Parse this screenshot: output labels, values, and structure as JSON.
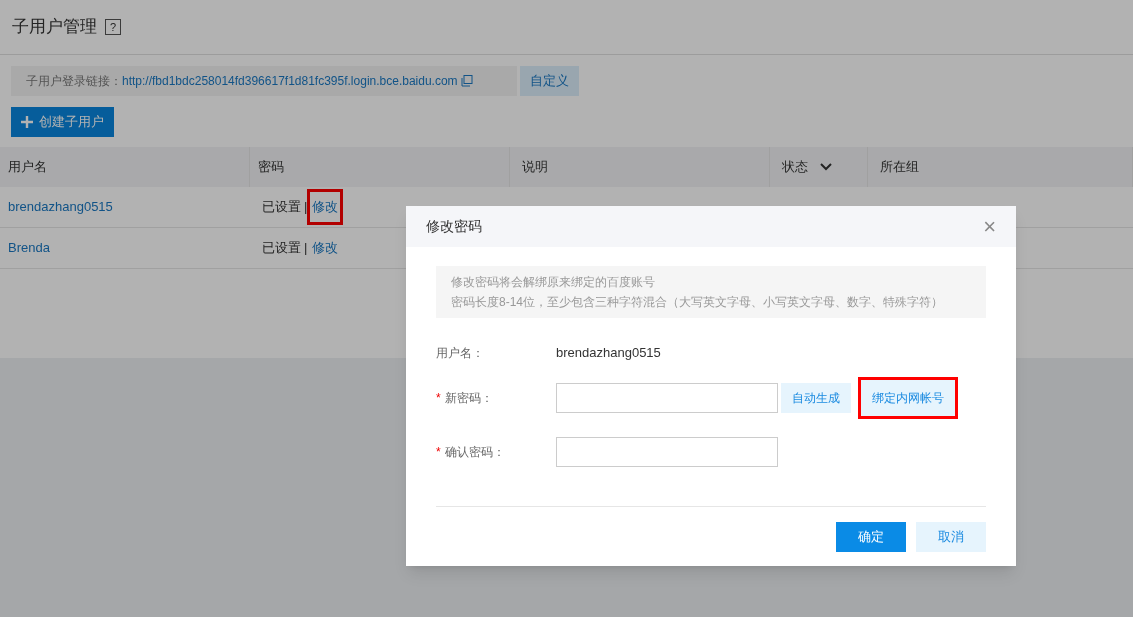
{
  "page": {
    "title": "子用户管理",
    "help": "?"
  },
  "login_link": {
    "label": "子用户登录链接：",
    "url": "http://fbd1bdc258014fd396617f1d81fc395f.login.bce.baidu.com",
    "customize": "自定义"
  },
  "create_button": "创建子用户",
  "table": {
    "columns": [
      {
        "label": "用户名",
        "sortable": false
      },
      {
        "label": "密码",
        "sortable": false
      },
      {
        "label": "说明",
        "sortable": false
      },
      {
        "label": "状态",
        "sortable": true
      },
      {
        "label": "所在组",
        "sortable": false
      }
    ],
    "rows": [
      {
        "username": "brendazhang0515",
        "password": "已设置",
        "separator": "|",
        "edit": "修改",
        "highlighted": true
      },
      {
        "username": "Brenda",
        "password": "已设置",
        "separator": "|",
        "edit": "修改",
        "highlighted": false
      }
    ]
  },
  "dialog": {
    "title": "修改密码",
    "close": "×",
    "notice": [
      "修改密码将会解绑原来绑定的百度账号",
      "密码长度8-14位，至少包含三种字符混合（大写英文字母、小写英文字母、数字、特殊字符）"
    ],
    "username_label": "用户名：",
    "username": "brendazhang0515",
    "fields": [
      {
        "label": "新密码：",
        "required": true,
        "required_mark": "*",
        "buttons": [
          {
            "label": "自动生成",
            "highlighted": false
          },
          {
            "label": "绑定内网帐号",
            "highlighted": true
          }
        ]
      },
      {
        "label": "确认密码：",
        "required": true,
        "required_mark": "*"
      }
    ],
    "ok": "确定",
    "cancel": "取消"
  }
}
